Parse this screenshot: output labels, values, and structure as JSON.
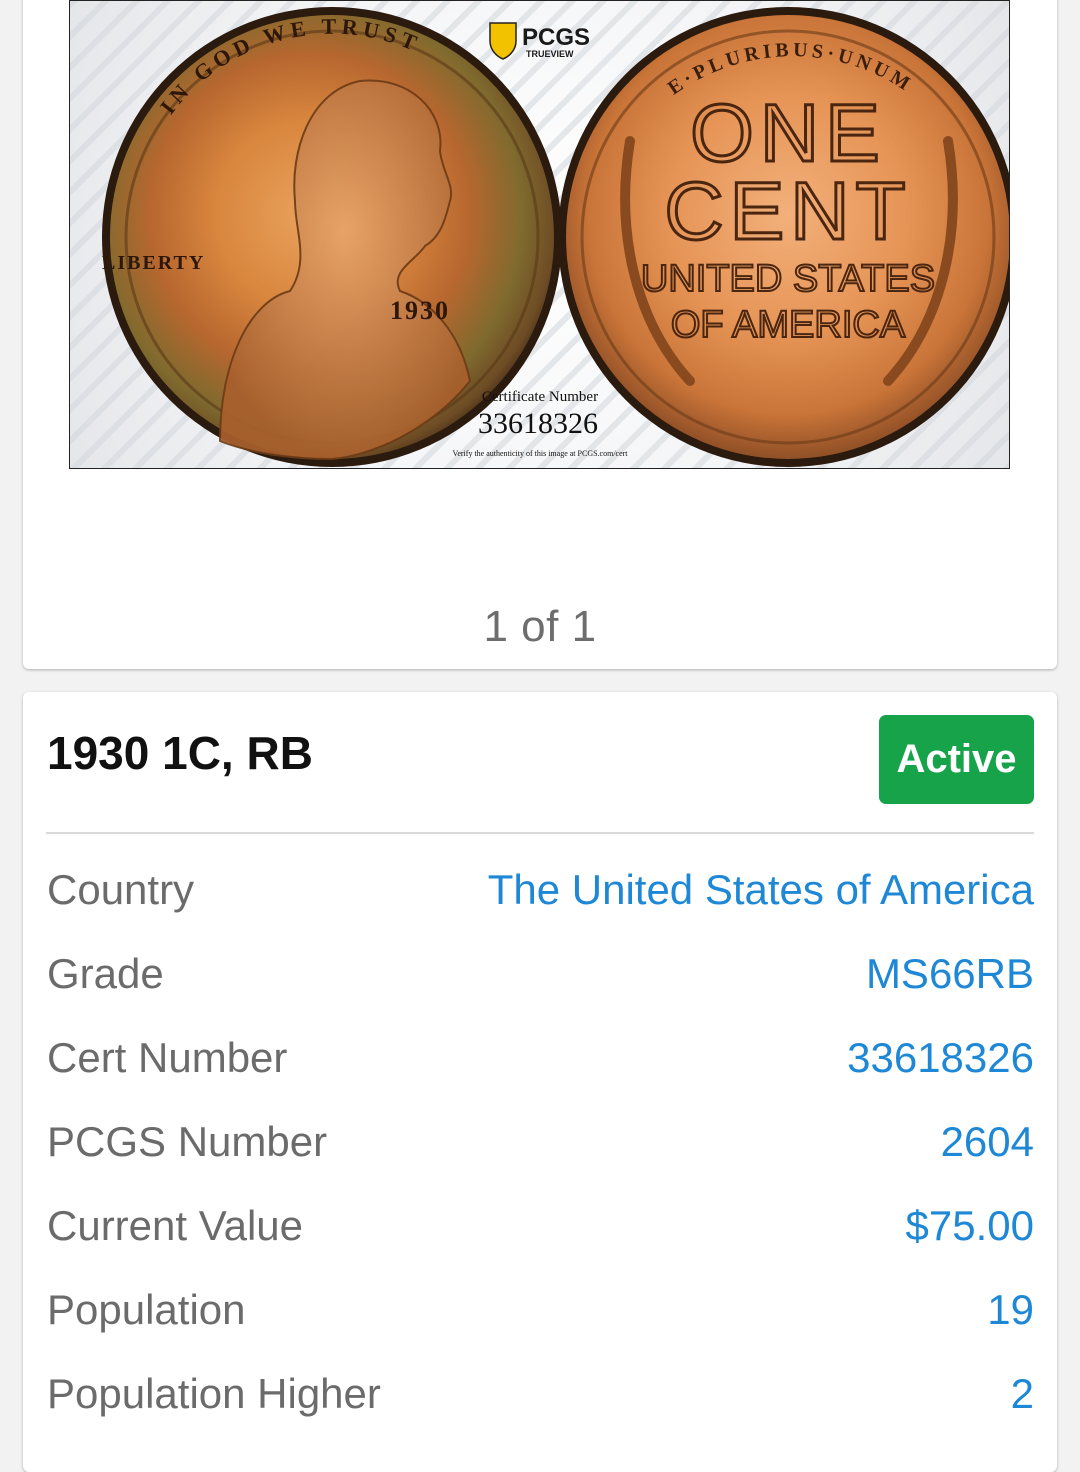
{
  "gallery": {
    "image": {
      "logo_text": "PCGS",
      "logo_subtext": "TRUEVIEW",
      "obverse_legend": "IN GOD WE TRUST",
      "obverse_liberty": "LIBERTY",
      "obverse_date": "1930",
      "reverse_legend": "E·PLURIBUS·UNUM",
      "reverse_denomination_line1": "ONE",
      "reverse_denomination_line2": "CENT",
      "reverse_country_line1": "UNITED STATES",
      "reverse_country_line2": "OF AMERICA",
      "cert_label": "Certificate Number",
      "cert_number": "33618326",
      "verify_text": "Verify the authenticity of this image at PCGS.com/cert"
    },
    "pager_text": "1 of 1"
  },
  "details": {
    "title": "1930 1C, RB",
    "status": "Active",
    "rows": [
      {
        "label": "Country",
        "value": "The United States of America"
      },
      {
        "label": "Grade",
        "value": "MS66RB"
      },
      {
        "label": "Cert Number",
        "value": "33618326"
      },
      {
        "label": "PCGS Number",
        "value": "2604"
      },
      {
        "label": "Current Value",
        "value": "$75.00"
      },
      {
        "label": "Population",
        "value": "19"
      },
      {
        "label": "Population Higher",
        "value": "2"
      }
    ]
  },
  "colors": {
    "status_green": "#16a34a",
    "link_blue": "#1e88d6",
    "label_gray": "#6b6b6b"
  }
}
